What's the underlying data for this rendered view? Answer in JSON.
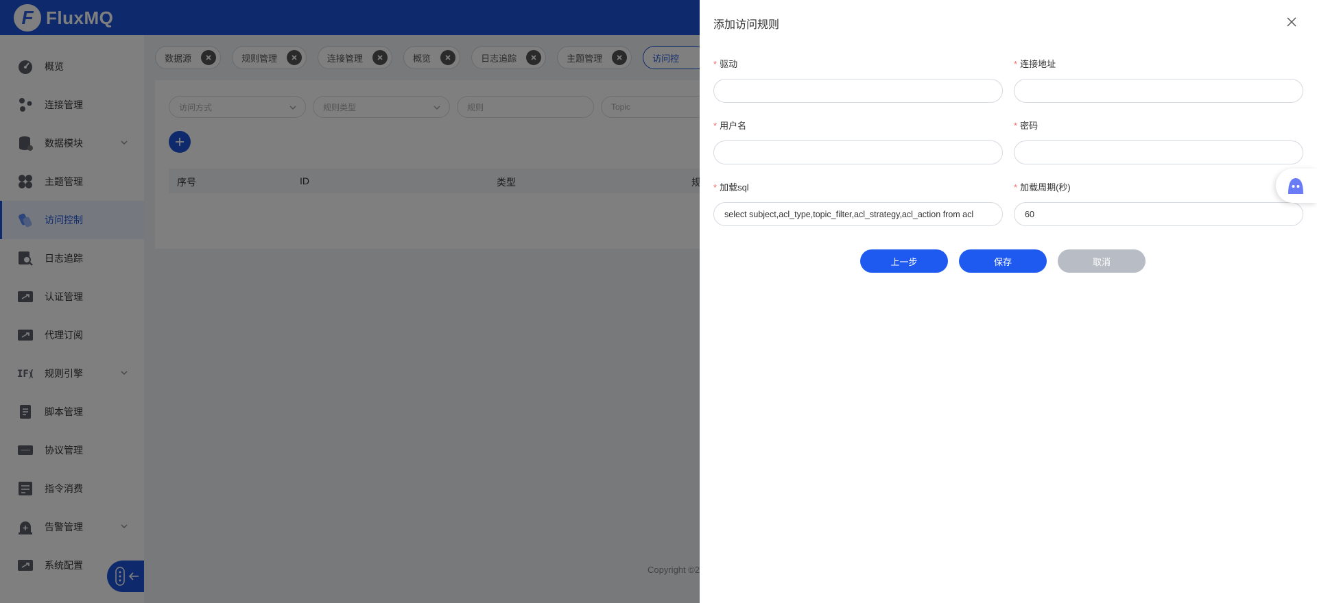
{
  "app": {
    "logo_letter": "F",
    "name": "FluxMQ",
    "brand_color": "#1f54d8"
  },
  "sidebar": {
    "items": [
      {
        "label": "概览",
        "icon": "dashboard-icon",
        "expandable": false,
        "active": false
      },
      {
        "label": "连接管理",
        "icon": "connections-icon",
        "expandable": false,
        "active": false
      },
      {
        "label": "数据模块",
        "icon": "database-icon",
        "expandable": true,
        "active": false
      },
      {
        "label": "主题管理",
        "icon": "topics-icon",
        "expandable": false,
        "active": false
      },
      {
        "label": "访问控制",
        "icon": "access-control-icon",
        "expandable": false,
        "active": true
      },
      {
        "label": "日志追踪",
        "icon": "log-search-icon",
        "expandable": false,
        "active": false
      },
      {
        "label": "认证管理",
        "icon": "auth-icon",
        "expandable": false,
        "active": false
      },
      {
        "label": "代理订阅",
        "icon": "proxy-subscribe-icon",
        "expandable": false,
        "active": false
      },
      {
        "label": "规则引擎",
        "icon": "rule-engine-icon",
        "expandable": true,
        "active": false
      },
      {
        "label": "脚本管理",
        "icon": "script-icon",
        "expandable": false,
        "active": false
      },
      {
        "label": "协议管理",
        "icon": "protocol-icon",
        "expandable": false,
        "active": false
      },
      {
        "label": "指令消费",
        "icon": "command-icon",
        "expandable": false,
        "active": false
      },
      {
        "label": "告警管理",
        "icon": "alarm-icon",
        "expandable": true,
        "active": false
      },
      {
        "label": "系统配置",
        "icon": "settings-icon",
        "expandable": false,
        "active": false
      }
    ]
  },
  "tabs": [
    {
      "label": "数据源"
    },
    {
      "label": "规则管理"
    },
    {
      "label": "连接管理"
    },
    {
      "label": "概览"
    },
    {
      "label": "日志追踪"
    },
    {
      "label": "主题管理"
    },
    {
      "label": "访问控"
    }
  ],
  "filters": {
    "access_method": "访问方式",
    "rule_type": "规则类型",
    "rule": "规则",
    "topic": "Topic"
  },
  "table": {
    "headers": [
      "序号",
      "ID",
      "类型",
      "规"
    ]
  },
  "footer": {
    "copyright": "Copyright ©2"
  },
  "drawer": {
    "title": "添加访问规则",
    "fields": {
      "driver": {
        "label": "驱动",
        "value": ""
      },
      "url": {
        "label": "连接地址",
        "value": ""
      },
      "username": {
        "label": "用户名",
        "value": ""
      },
      "password": {
        "label": "密码",
        "value": ""
      },
      "load_sql": {
        "label": "加载sql",
        "value": "select subject,acl_type,topic_filter,acl_strategy,acl_action from acl"
      },
      "load_period": {
        "label": "加载周期(秒)",
        "value": "60"
      }
    },
    "buttons": {
      "prev": "上一步",
      "save": "保存",
      "cancel": "取消"
    }
  }
}
